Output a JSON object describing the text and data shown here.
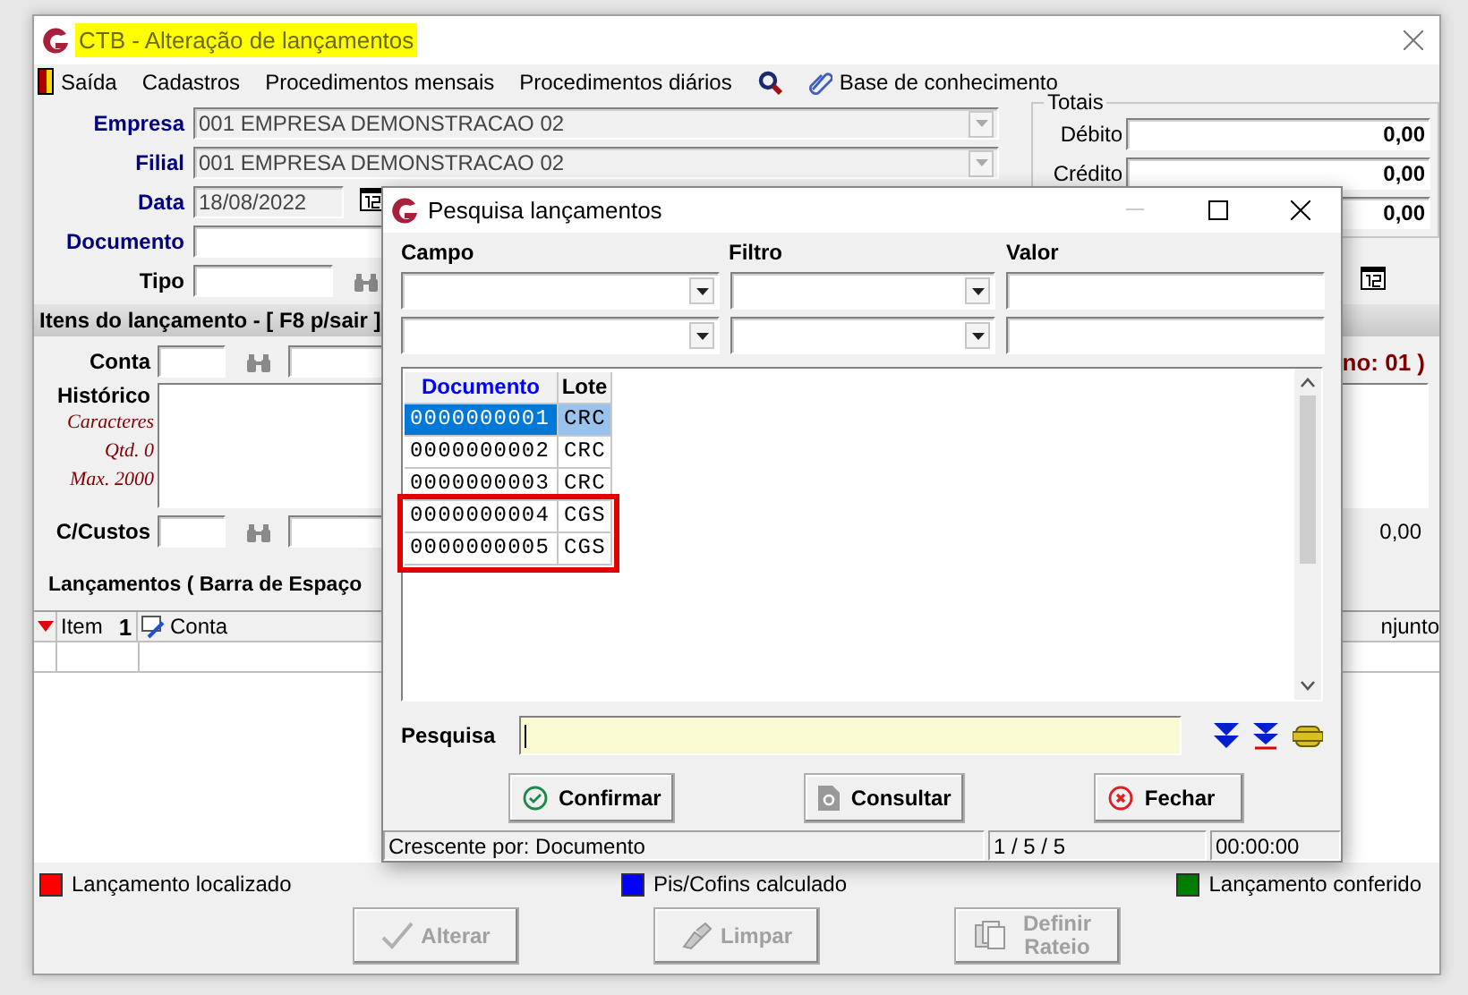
{
  "main_window": {
    "title": "CTB - Alteração de lançamentos",
    "title_highlighted": true
  },
  "menu": [
    {
      "kind": "exit",
      "label": "Saída"
    },
    {
      "kind": "text",
      "label": "Cadastros"
    },
    {
      "kind": "text",
      "label": "Procedimentos mensais"
    },
    {
      "kind": "text",
      "label": "Procedimentos diários"
    },
    {
      "kind": "search"
    },
    {
      "kind": "clip",
      "label": "Base de conhecimento"
    }
  ],
  "header_fields": [
    {
      "kind": "dropdown",
      "label": "Empresa",
      "required": true,
      "value": "001 EMPRESA DEMONSTRACAO 02"
    },
    {
      "kind": "dropdown",
      "label": "Filial",
      "required": true,
      "value": "001 EMPRESA DEMONSTRACAO 02"
    },
    {
      "kind": "date",
      "label": "Data",
      "required": true,
      "value": "18/08/2022"
    },
    {
      "kind": "text",
      "label": "Documento",
      "required": true
    },
    {
      "kind": "lookup",
      "label": "Tipo",
      "required": false
    }
  ],
  "totals": {
    "title": "Totais",
    "rows": [
      {
        "label": "Débito",
        "value": "0,00"
      },
      {
        "label": "Crédito",
        "value": "0,00"
      },
      {
        "value": "0,00"
      }
    ]
  },
  "items_section": {
    "title": "Itens do lançamento - [ F8 p/sair ]",
    "period": "no: 01 )",
    "account_label": "Conta",
    "history_label": "Histórico",
    "counter": [
      "Caracteres",
      "Qtd. 0",
      "Max. 2000"
    ],
    "cost_center_label": "C/Custos",
    "cost_center_value": "0,00"
  },
  "entries": {
    "title": "Lançamentos ( Barra de Espaço",
    "columns": [
      {
        "label": "Item",
        "sort_rank": "1"
      },
      {
        "label": "Conta"
      },
      {
        "label": "njunto"
      }
    ]
  },
  "legend": [
    {
      "label": "Lançamento localizado",
      "color": "#ff0000"
    },
    {
      "label": "Pis/Cofins calculado",
      "color": "#0000ff"
    },
    {
      "label": "Lançamento conferido",
      "color": "#008000"
    }
  ],
  "actions": [
    {
      "kind": "check",
      "label": "Alterar",
      "disabled": true
    },
    {
      "kind": "eraser",
      "label": "Limpar",
      "disabled": true
    },
    {
      "kind": "pages",
      "label": "Definir Rateio",
      "disabled": true
    }
  ],
  "dialog": {
    "title": "Pesquisa lançamentos",
    "filter_headers": [
      "Campo",
      "Filtro",
      "Valor"
    ],
    "filter_rows": [
      {
        "kind": "criteria"
      },
      {
        "kind": "criteria"
      }
    ],
    "columns": [
      {
        "label": "Documento",
        "sorted": true
      },
      {
        "label": "Lote",
        "sorted": false
      }
    ],
    "rows": [
      {
        "cells": [
          "0000000001",
          "CRC"
        ],
        "selected": true,
        "marked": false
      },
      {
        "cells": [
          "0000000002",
          "CRC"
        ],
        "selected": false,
        "marked": false
      },
      {
        "cells": [
          "0000000003",
          "CRC"
        ],
        "selected": false,
        "marked": false
      },
      {
        "cells": [
          "0000000004",
          "CGS"
        ],
        "selected": false,
        "marked": true
      },
      {
        "cells": [
          "0000000005",
          "CGS"
        ],
        "selected": false,
        "marked": true
      }
    ],
    "search_label": "Pesquisa",
    "buttons": [
      {
        "kind": "confirm",
        "label": "Confirmar"
      },
      {
        "kind": "consult",
        "label": "Consultar"
      },
      {
        "kind": "close",
        "label": "Fechar"
      }
    ],
    "status": [
      "Crescente por: Documento",
      "1 / 5 / 5",
      "00:00:00"
    ]
  }
}
